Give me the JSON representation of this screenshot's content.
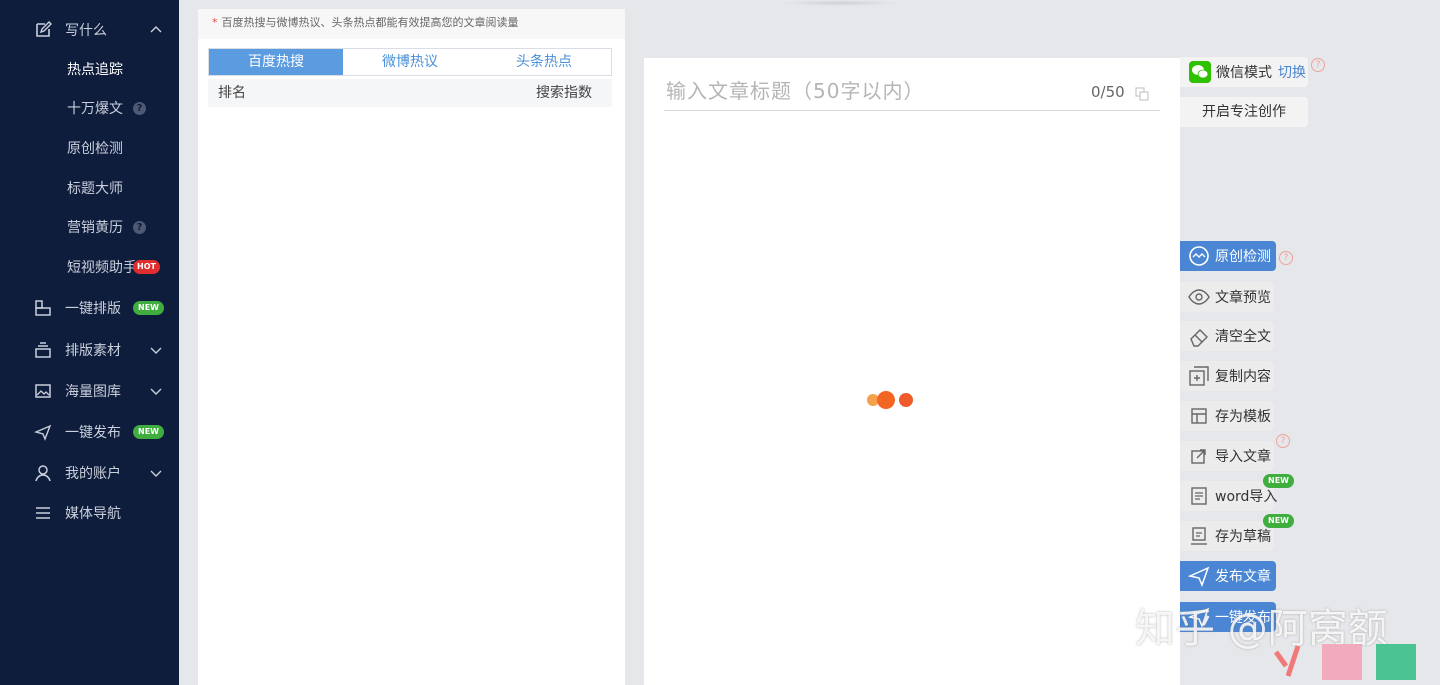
{
  "sidebar": {
    "sections": [
      {
        "label": "写什么",
        "expanded": true
      },
      {
        "label": "一键排版",
        "badge": "NEW"
      },
      {
        "label": "排版素材"
      },
      {
        "label": "海量图库"
      },
      {
        "label": "一键发布",
        "badge": "NEW"
      },
      {
        "label": "我的账户"
      },
      {
        "label": "媒体导航"
      }
    ],
    "sub_items": [
      {
        "label": "热点追踪",
        "active": true
      },
      {
        "label": "十万爆文",
        "help": "?"
      },
      {
        "label": "原创检测"
      },
      {
        "label": "标题大师"
      },
      {
        "label": "营销黄历",
        "help": "?"
      },
      {
        "label": "短视频助手",
        "badge": "HOT"
      }
    ]
  },
  "hot_panel": {
    "hint_star": "*",
    "hint": "百度热搜与微博热议、头条热点都能有效提高您的文章阅读量",
    "tabs": [
      {
        "label": "百度热搜",
        "active": true
      },
      {
        "label": "微博热议"
      },
      {
        "label": "头条热点"
      }
    ],
    "col_rank": "排名",
    "col_index": "搜索指数"
  },
  "editor": {
    "title_placeholder": "输入文章标题（50字以内）",
    "title_value": "",
    "count": "0/50"
  },
  "tools": {
    "wechat_mode": "微信模式",
    "switch": "切换",
    "focus": "开启专注创作",
    "help": "?",
    "new_badge": "NEW",
    "items": [
      {
        "label": "原创检测"
      },
      {
        "label": "文章预览"
      },
      {
        "label": "清空全文"
      },
      {
        "label": "复制内容"
      },
      {
        "label": "存为模板"
      },
      {
        "label": "导入文章"
      },
      {
        "label": "word导入"
      },
      {
        "label": "存为草稿"
      },
      {
        "label": "发布文章"
      },
      {
        "label": "一键发布"
      }
    ]
  },
  "watermark": "知乎 @阿窝额",
  "colors": {
    "sidebar_bg": "#0f1d3c",
    "accent_blue": "#4a86d4",
    "tab_blue": "#5b9be0",
    "hot_red": "#e02d2d",
    "new_green": "#3fae3f",
    "loader_orange": "#f26522"
  }
}
